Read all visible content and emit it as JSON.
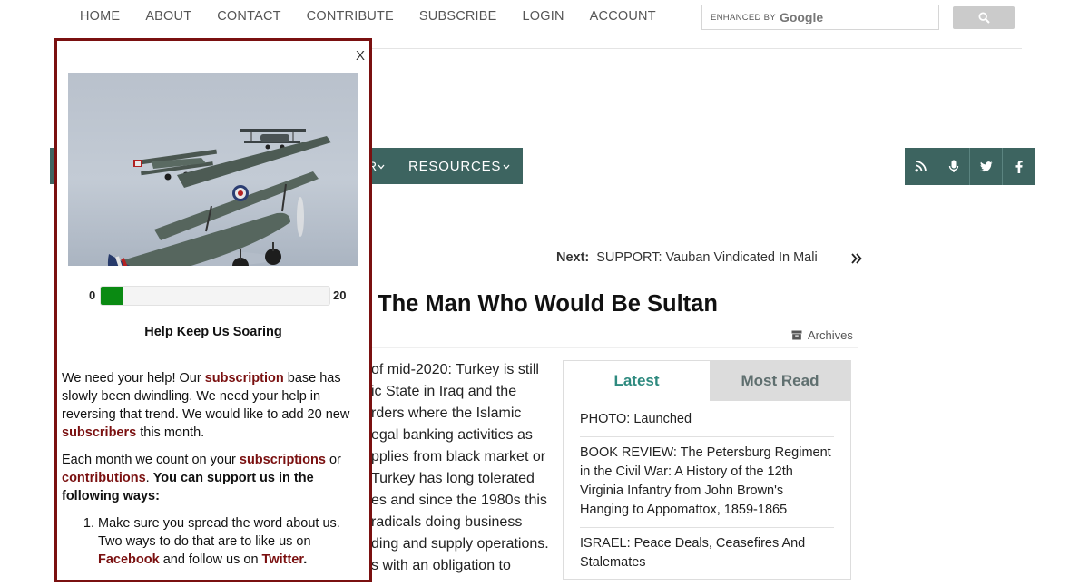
{
  "topnav": {
    "items": [
      "HOME",
      "ABOUT",
      "CONTACT",
      "CONTRIBUTE",
      "SUBSCRIBE",
      "LOGIN",
      "ACCOUNT"
    ]
  },
  "search": {
    "enhanced_label": "ENHANCED BY",
    "brand": "Google",
    "icon": "search-icon"
  },
  "mainnav": {
    "partial_item": "R",
    "resources_label": "RESOURCES"
  },
  "social": {
    "icons": [
      "rss-icon",
      "microphone-icon",
      "twitter-icon",
      "facebook-icon"
    ]
  },
  "article": {
    "next_label": "Next:",
    "next_title": "SUPPORT: Vauban Vindicated In Mali",
    "headline": "The Man Who Would Be Sultan",
    "archives_label": "Archives",
    "body_lines": [
      "of mid-2020: Turkey is still",
      "ic State in Iraq and the",
      "rders where the Islamic",
      "egal banking activities as",
      "pplies from black market or",
      "Turkey has long tolerated",
      "es and since the 1980s this",
      " radicals doing business",
      "ding and supply operations.",
      "s with an obligation to"
    ]
  },
  "widget": {
    "tab_latest": "Latest",
    "tab_most_read": "Most Read",
    "items": [
      "PHOTO: Launched",
      "BOOK REVIEW: The Petersburg Regiment in the Civil War: A History of the 12th Virginia Infantry from John Brown's Hanging to Appomattox, 1859-1865",
      "ISRAEL: Peace Deals, Ceasefires And Stalemates"
    ]
  },
  "popup": {
    "close_label": "X",
    "progress": {
      "min_label": "0",
      "max_label": "20",
      "fraction": 0.1
    },
    "title": "Help Keep Us Soaring",
    "p1": {
      "t1": "We need your help! Our ",
      "link1": "subscription",
      "t2": " base has slowly been dwindling. We need your help in reversing that trend. We would like to add 20 new ",
      "link2": "subscribers",
      "t3": " this month."
    },
    "p2": {
      "t1": "Each month we count on your ",
      "link1": "subscriptions",
      "t2": " or ",
      "link2": "contributions",
      "t3": ". ",
      "strong": "You can support us in the following ways:"
    },
    "li1": {
      "t1": "Make sure you spread the word about us. Two ways to do that are to like us on ",
      "link1": "Facebook",
      "t2": " and follow us on ",
      "link2": "Twitter",
      "t3": "."
    }
  },
  "colors": {
    "nav_teal": "#3d6460",
    "popup_border": "#7a1010",
    "link_red": "#7a1010",
    "progress_green": "#0a8a12",
    "tab_active_text": "#2e8a7f"
  }
}
